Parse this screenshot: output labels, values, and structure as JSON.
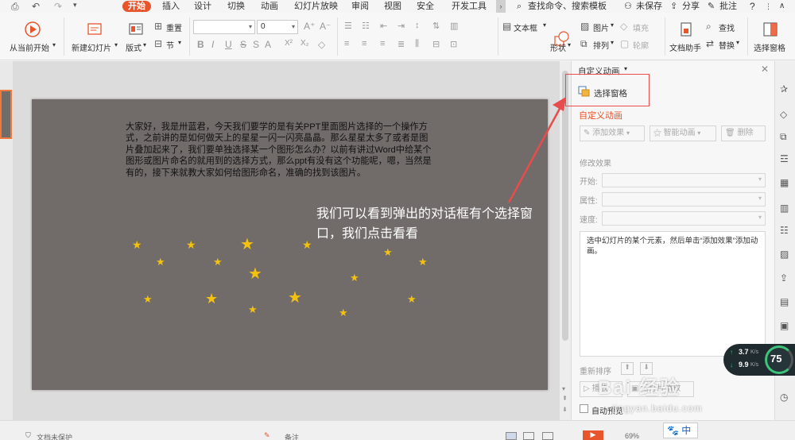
{
  "menubar": {
    "tabs": [
      "开始",
      "插入",
      "设计",
      "切换",
      "动画",
      "幻灯片放映",
      "审阅",
      "视图",
      "安全",
      "开发工具"
    ],
    "search": "查找命令、搜索模板",
    "unsaved": "未保存",
    "share": "分享",
    "comment": "批注",
    "help": "?"
  },
  "ribbon": {
    "from_current": "从当前开始",
    "new_slide": "新建幻灯片",
    "layout": "版式",
    "reset": "重置",
    "section": "节",
    "font_size": "0",
    "textbox": "文本框",
    "shape": "形状",
    "picture": "图片",
    "fill": "填充",
    "arrange": "排列",
    "outline": "轮廓",
    "doc_assistant": "文档助手",
    "find": "查找",
    "replace": "替换",
    "select_pane": "选择窗格"
  },
  "slide": {
    "paragraph": "大家好，我是卅蓝君，今天我们要学的是有关PPT里面图片选择的一个操作方式，之前讲的是如何做天上的星星一闪一闪亮晶晶。那么星星太多了或者是图片叠加起来了，我们要单独选择某一个图形怎么办？以前有讲过Word中给某个图形或图片命名的就用到的选择方式，那么ppt有没有这个功能呢，嗯，当然是有的，接下来就教大家如何给图形命名，准确的找到该图片。",
    "note": "我们可以看到弹出的对话框有个选择窗口，我们点击看看"
  },
  "pane": {
    "header": "自定义动画",
    "select_pane": "选择窗格",
    "section_title": "自定义动画",
    "add_effect": "添加效果",
    "smart_anim": "智能动画",
    "delete": "删除",
    "modify": "修改效果",
    "start": "开始:",
    "property": "属性:",
    "speed": "速度:",
    "hint": "选中幻灯片的某个元素，然后单击“添加效果”添加动画。",
    "reorder": "重新排序",
    "play": "播放",
    "slideshow": "幻灯片播放",
    "autopreview": "自动预览"
  },
  "status": {
    "left": "文档未保护",
    "notes": "备注",
    "zoom": "69%",
    "ime": "中"
  },
  "overlay": {
    "up": "3.7",
    "down": "9.9",
    "unit": "K/s",
    "pct": "75",
    "watermark": "Bai 经验",
    "url": "jingyan.baidu.com"
  },
  "colors": {
    "accent": "#e8542c",
    "slide_bg": "#716b69",
    "star": "#f4c20d",
    "highlight": "#e84c4c"
  }
}
